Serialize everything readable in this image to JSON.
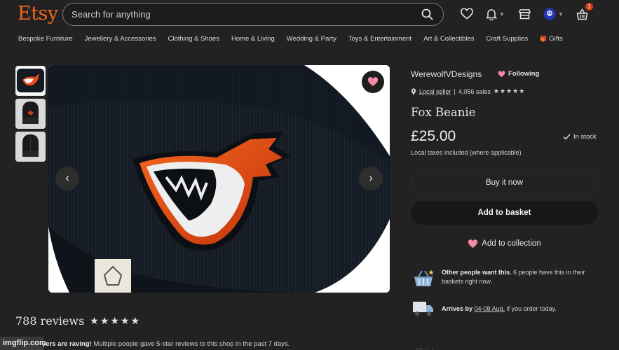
{
  "header": {
    "logo": "Etsy",
    "search_placeholder": "Search for anything",
    "cart_count": "1",
    "colors": {
      "logo": "#f1641e",
      "badge": "#cf4018"
    }
  },
  "nav": {
    "categories": [
      "Bespoke Furniture",
      "Jewellery & Accessories",
      "Clothing & Shoes",
      "Home & Living",
      "Wedding & Party",
      "Toys & Entertainment",
      "Art & Collectibles",
      "Craft Supplies",
      "Gifts"
    ]
  },
  "product": {
    "shop_name": "WerewolfVDesigns",
    "following_label": "Following",
    "local_seller": "Local seller",
    "separator": "|",
    "sales": "4,056 sales",
    "rating_stars": "★★★★★",
    "title": "Fox Beanie",
    "price": "£25.00",
    "stock": "In stock",
    "tax_note": "Local taxes included (where applicable)",
    "buy_now": "Buy it now",
    "add_to_basket": "Add to basket",
    "add_to_collection": "Add to collection",
    "demand": {
      "bold": "Other people want this.",
      "rest": " 6 people have this in their baskets right now."
    },
    "delivery": {
      "prefix": "Arrives by ",
      "dates": "04-08 Aug.",
      "suffix": " if you order today."
    }
  },
  "reviews": {
    "title": "788 reviews",
    "stars": "★★★★★",
    "note_bold": "yers are raving!",
    "note_rest": " Multiple people gave 5-star reviews to this shop in the past 7 days."
  },
  "watermark": "imgflip.com"
}
